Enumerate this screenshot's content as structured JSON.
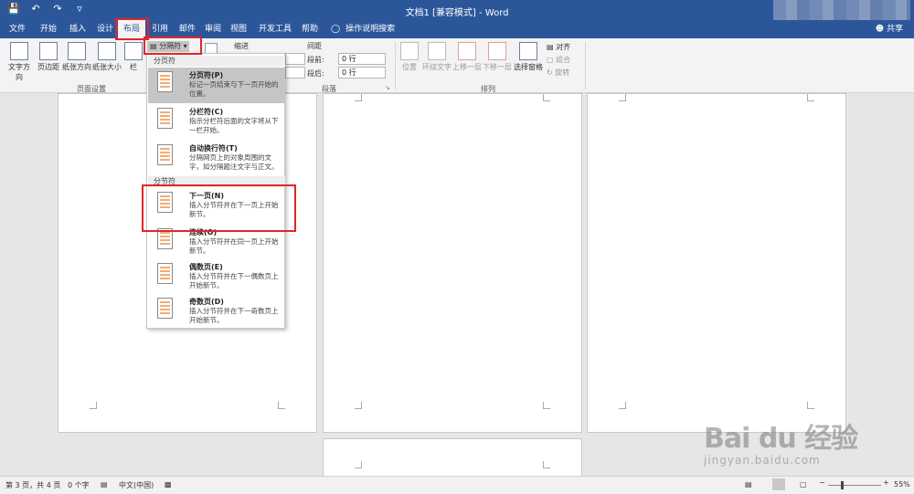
{
  "titlebar": {
    "doc_title": "文档1 [兼容模式] - Word",
    "qat": [
      "save-icon",
      "undo-icon",
      "redo-icon",
      "customize-icon"
    ]
  },
  "tabs": [
    {
      "label": "文件"
    },
    {
      "label": "开始"
    },
    {
      "label": "插入"
    },
    {
      "label": "设计"
    },
    {
      "label": "布局"
    },
    {
      "label": "引用"
    },
    {
      "label": "邮件"
    },
    {
      "label": "审阅"
    },
    {
      "label": "视图"
    },
    {
      "label": "开发工具"
    },
    {
      "label": "帮助"
    }
  ],
  "tell_me": "操作说明搜索",
  "share": "共享",
  "ribbon": {
    "text_direction": "文字方向",
    "margins": "页边距",
    "orientation": "纸张方向",
    "size": "纸张大小",
    "columns": "栏",
    "breaks": "分隔符",
    "indent": "缩进",
    "spacing": "间距",
    "before_label": "段前:",
    "before_value": "0 行",
    "after_label": "段后:",
    "after_value": "0 行",
    "page_setup_group": "页面设置",
    "paragraph_group": "段落",
    "position": "位置",
    "wrap_text": "环绕文字",
    "bring_forward": "上移一层",
    "send_backward": "下移一层",
    "selection_pane": "选择窗格",
    "align": "对齐",
    "group": "组合",
    "rotate": "旋转",
    "arrange_group": "排列"
  },
  "breaks_menu": {
    "page_breaks_header": "分页符",
    "section_breaks_header": "分节符",
    "items": [
      {
        "title": "分页符(P)",
        "desc": "标记一页结束与下一页开始的位置。"
      },
      {
        "title": "分栏符(C)",
        "desc": "指示分栏符后面的文字将从下一栏开始。"
      },
      {
        "title": "自动换行符(T)",
        "desc": "分隔网页上的对象周围的文字，如分隔题注文字与正文。"
      },
      {
        "title": "下一页(N)",
        "desc": "插入分节符并在下一页上开始新节。"
      },
      {
        "title": "连续(O)",
        "desc": "插入分节符并在同一页上开始新节。"
      },
      {
        "title": "偶数页(E)",
        "desc": "插入分节符并在下一偶数页上开始新节。"
      },
      {
        "title": "奇数页(D)",
        "desc": "插入分节符并在下一奇数页上开始新节。"
      }
    ]
  },
  "statusbar": {
    "page": "第 3 页，共 4 页",
    "words": "0 个字",
    "language": "中文(中国)",
    "zoom": "55%",
    "zoom_level": 0.55
  },
  "watermark": {
    "brand": "Bai du 经验",
    "url": "jingyan.baidu.com"
  },
  "colors": {
    "accent": "#2b579a",
    "highlight": "#e0262b"
  }
}
